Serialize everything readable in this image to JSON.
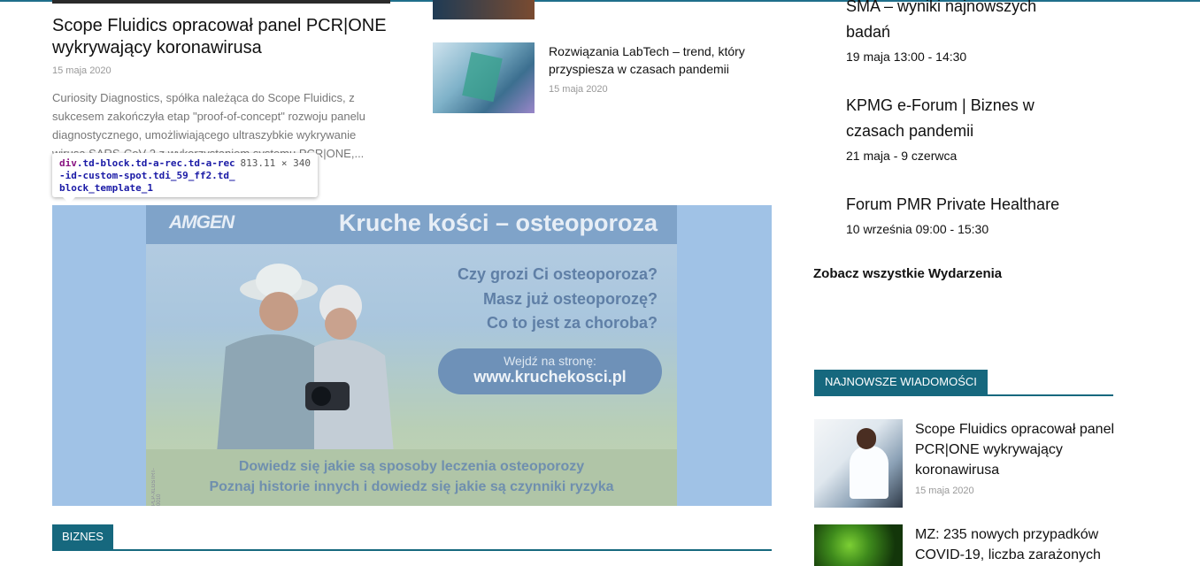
{
  "lead_article": {
    "title": "Scope Fluidics opracował panel PCR|ONE wykrywający koronawirusa",
    "date": "15 maja 2020",
    "excerpt": "Curiosity Diagnostics, spółka należąca do Scope Fluidics, z sukcesem zakończyła etap \"proof-of-concept\" rozwoju panelu diagnostycznego, umożliwiającego ultraszybkie wykrywanie wirusa SARS-CoV-2 z wykorzystaniem systemu PCR|ONE,..."
  },
  "mid_article": {
    "title": "Rozwiązania LabTech – trend, który przyspiesza w czasach pandemii",
    "date": "15 maja 2020"
  },
  "devtools_tooltip": {
    "tag": "div",
    "classes": ".td-block.td-a-rec.td-a-rec-id-custom-spot.tdi_59_ff2.td_block_template_1",
    "size": "813.11 × 340"
  },
  "ad": {
    "logo": "AMGEN",
    "headline": "Kruche kości – osteoporoza",
    "questions": [
      "Czy grozi Ci osteoporoza?",
      "Masz już osteoporozę?",
      "Co to jest za choroba?"
    ],
    "cta_small": "Wejdź na stronę:",
    "cta_url": "www.kruchekosci.pl",
    "footer_line1": "Dowiedz się jakie są sposoby leczenia osteoporozy",
    "footer_line2": "Poznaj historie innych i dowiedz się jakie są czynniki ryzyka",
    "code": "PLP-XLGSTRT-0010"
  },
  "section_biznes": {
    "label": "BIZNES"
  },
  "events": [
    {
      "title": "SMA – wyniki najnowszych badań",
      "date": "19 maja 13:00 - 14:30"
    },
    {
      "title": "KPMG e-Forum | Biznes w czasach pandemii",
      "date": "21 maja - 9 czerwca"
    },
    {
      "title": "Forum PMR Private Healthare",
      "date": "10 września 09:00 - 15:30"
    }
  ],
  "see_all_events": "Zobacz wszystkie Wydarzenia",
  "latest_news": {
    "label": "NAJNOWSZE WIADOMOŚCI",
    "items": [
      {
        "title": "Scope Fluidics opracował panel PCR|ONE wykrywający koronawirusa",
        "date": "15 maja 2020"
      },
      {
        "title": "MZ: 235 nowych przypadków COVID-19, liczba zarażonych"
      }
    ]
  },
  "colors": {
    "accent": "#16687e",
    "ad_highlight": "#a0c2e6"
  }
}
